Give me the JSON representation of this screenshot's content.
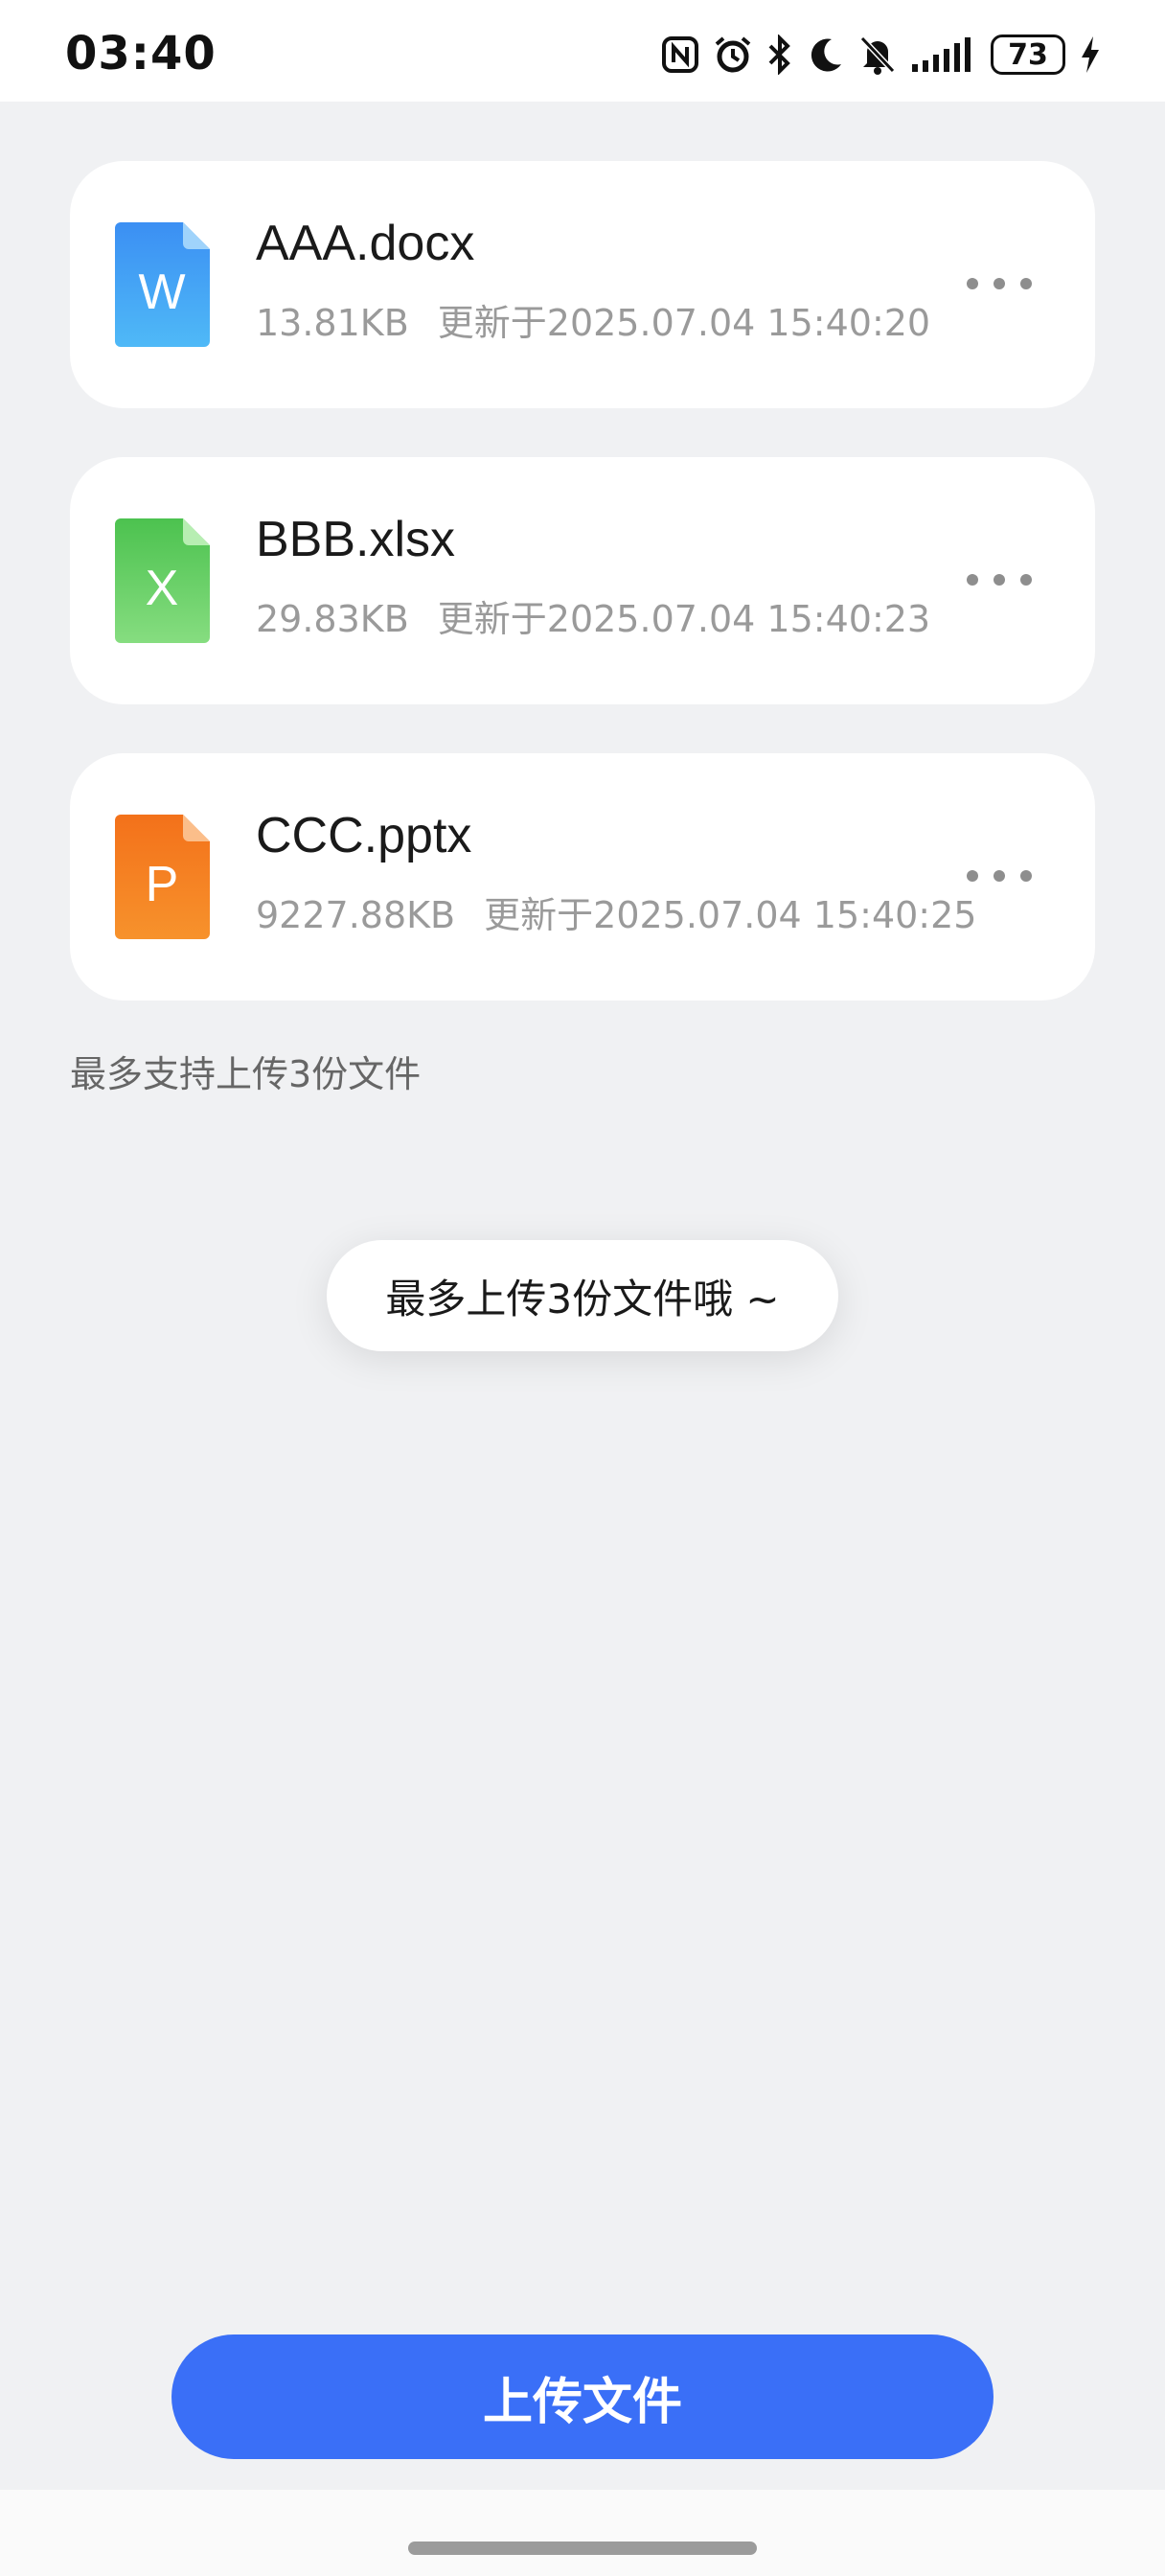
{
  "status_bar": {
    "time": "03:40",
    "battery": "73",
    "icons": [
      "nfc-icon",
      "alarm-icon",
      "bluetooth-icon",
      "moon-icon",
      "mute-bell-icon",
      "signal-icon",
      "battery-icon",
      "charging-icon"
    ]
  },
  "files": [
    {
      "name": "AAA.docx",
      "size": "13.81KB",
      "updated": "更新于2025.07.04 15:40:20",
      "icon": "word-file-icon",
      "icon_letter": "W",
      "icon_color": "#3d9cf5"
    },
    {
      "name": "BBB.xlsx",
      "size": "29.83KB",
      "updated": "更新于2025.07.04 15:40:23",
      "icon": "excel-file-icon",
      "icon_letter": "X",
      "icon_color": "#5ccf5f"
    },
    {
      "name": "CCC.pptx",
      "size": "9227.88KB",
      "updated": "更新于2025.07.04 15:40:25",
      "icon": "powerpoint-file-icon",
      "icon_letter": "P",
      "icon_color": "#f5801f"
    }
  ],
  "hint": "最多支持上传3份文件",
  "toast": "最多上传3份文件哦 ~",
  "upload_button": "上传文件",
  "colors": {
    "accent": "#3a6ff7",
    "background": "#f0f1f3",
    "card": "#ffffff"
  }
}
